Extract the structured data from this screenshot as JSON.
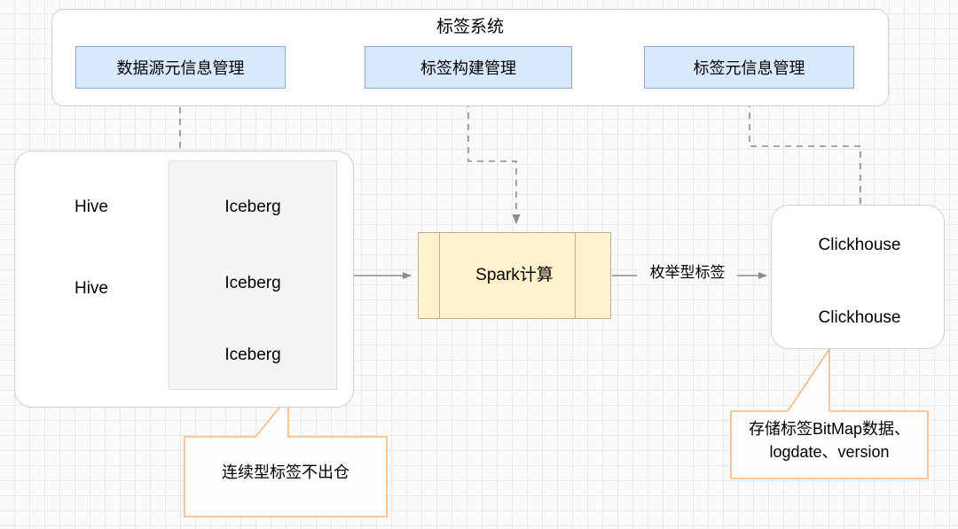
{
  "diagram": {
    "title": "标签系统",
    "label_system": {
      "modules": [
        {
          "id": "datasource-meta-mgmt",
          "label": "数据源元信息管理"
        },
        {
          "id": "tag-build-mgmt",
          "label": "标签构建管理"
        },
        {
          "id": "tag-meta-mgmt",
          "label": "标签元信息管理"
        }
      ]
    },
    "source_group": {
      "hive_nodes": [
        {
          "label": "Hive"
        },
        {
          "label": "Hive"
        }
      ],
      "iceberg_nodes": [
        {
          "label": "Iceberg"
        },
        {
          "label": "Iceberg"
        },
        {
          "label": "Iceberg"
        }
      ]
    },
    "compute": {
      "label": "Spark计算"
    },
    "storage_group": {
      "nodes": [
        {
          "label": "Clickhouse"
        },
        {
          "label": "Clickhouse"
        }
      ]
    },
    "edges": [
      {
        "id": "spark-to-clickhouse",
        "label": "枚举型标签"
      }
    ],
    "callouts": [
      {
        "id": "continuous-tag-note",
        "text": "连续型标签不出仓"
      },
      {
        "id": "bitmap-storage-note",
        "text": "存储标签BitMap数据、logdate、version"
      }
    ],
    "colors": {
      "module_fill": "#dae8fc",
      "module_stroke": "#8ba7d4",
      "hive_fill": "#d5e8d4",
      "hive_stroke": "#82b366",
      "iceberg_fill": "#dae8fc",
      "iceberg_stroke": "#8ba7d4",
      "spark_fill": "#fff2cc",
      "spark_stroke": "#bdb08b",
      "callout_stroke": "#f5b97f",
      "edge_stroke": "#808080",
      "group_stroke": "#cfcfcf"
    }
  }
}
